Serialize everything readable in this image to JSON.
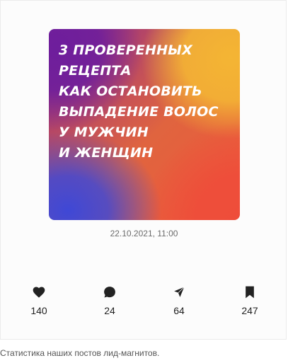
{
  "post": {
    "title_lines": [
      "3 ПРОВЕРЕННЫХ",
      "РЕЦЕПТА",
      "КАК ОСТАНОВИТЬ",
      "ВЫПАДЕНИЕ ВОЛОС",
      "У МУЖЧИН",
      "И ЖЕНЩИН"
    ],
    "timestamp": "22.10.2021, 11:00",
    "gradient_colors": [
      "#6e1e9c",
      "#f4b534",
      "#ee4d3a",
      "#3f48d6"
    ]
  },
  "stats": {
    "likes": {
      "icon": "heart-icon",
      "value": "140"
    },
    "comments": {
      "icon": "comment-icon",
      "value": "24"
    },
    "shares": {
      "icon": "send-icon",
      "value": "64"
    },
    "saves": {
      "icon": "bookmark-icon",
      "value": "247"
    },
    "icon_color": "#222222"
  },
  "caption": "Статистика наших постов лид-магнитов."
}
